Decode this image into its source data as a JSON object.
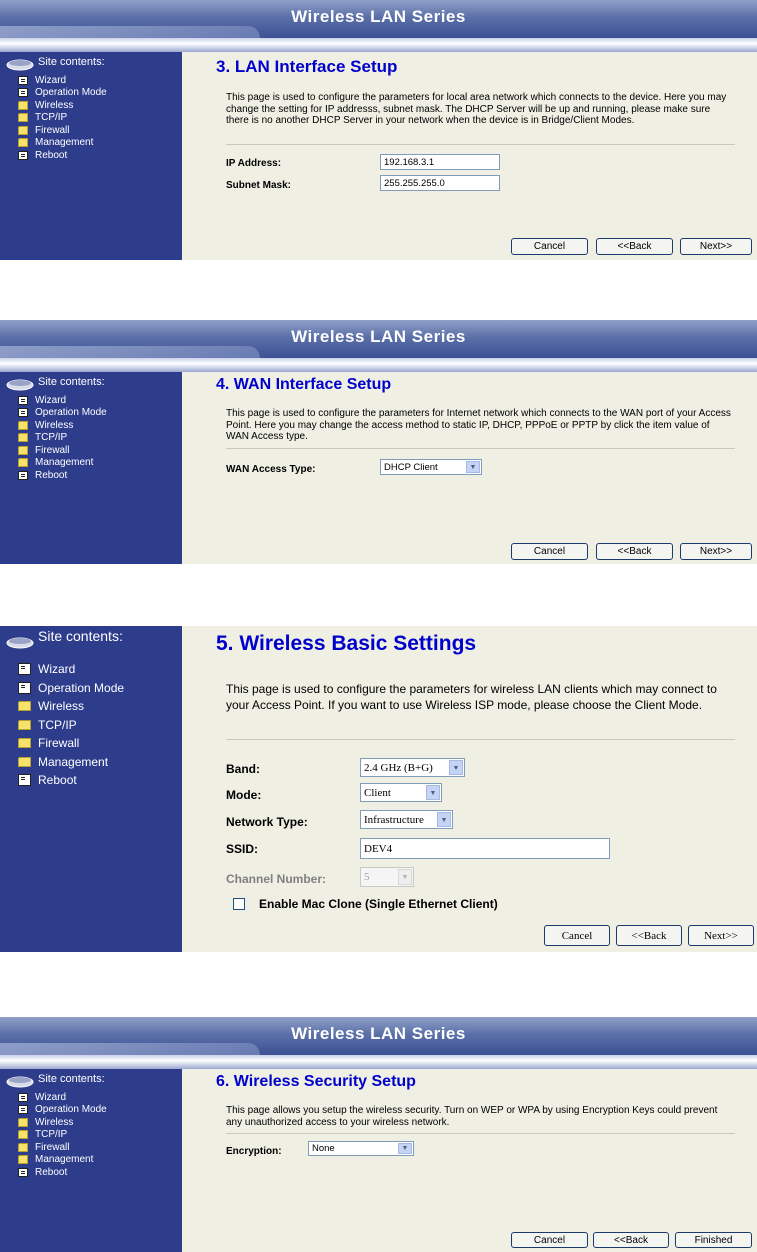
{
  "app_title": "Wireless LAN Series",
  "site_contents": "Site contents:",
  "nav": [
    "Wizard",
    "Operation Mode",
    "Wireless",
    "TCP/IP",
    "Firewall",
    "Management",
    "Reboot"
  ],
  "buttons": {
    "cancel": "Cancel",
    "back": "<<Back",
    "next": "Next>>",
    "finished": "Finished"
  },
  "panels": {
    "lan": {
      "heading": "3. LAN Interface Setup",
      "desc": "This page is used to configure the parameters for local area network which connects to the device. Here you may change the setting for IP addresss, subnet mask. The DHCP Server will be up and running, please make sure there is no another DHCP Server in your network when the device is in Bridge/Client Modes.",
      "ip_label": "IP Address:",
      "ip_value": "192.168.3.1",
      "mask_label": "Subnet Mask:",
      "mask_value": "255.255.255.0"
    },
    "wan": {
      "heading": "4. WAN Interface Setup",
      "desc": "This page is used to configure the parameters for Internet network which connects to the WAN port of your Access Point. Here you may change the access method to static IP, DHCP, PPPoE or PPTP by click the item value of WAN Access type.",
      "type_label": "WAN Access Type:",
      "type_value": "DHCP Client"
    },
    "wireless": {
      "heading": "5. Wireless Basic Settings",
      "desc": "This page is used to configure the parameters for wireless LAN clients which may connect to your Access Point. If you want to use Wireless ISP mode, please choose the Client Mode.",
      "band_label": "Band:",
      "band_value": "2.4 GHz (B+G)",
      "mode_label": "Mode:",
      "mode_value": "Client",
      "nettype_label": "Network Type:",
      "nettype_value": "Infrastructure",
      "ssid_label": "SSID:",
      "ssid_value": "DEV4",
      "channel_label": "Channel Number:",
      "channel_value": "5",
      "mac_clone_label": "Enable Mac Clone (Single Ethernet Client)"
    },
    "security": {
      "heading": "6. Wireless Security Setup",
      "desc": "This page allows you setup the wireless security. Turn on WEP or WPA by using Encryption Keys could prevent any unauthorized access to your wireless network.",
      "enc_label": "Encryption:",
      "enc_value": "None"
    }
  }
}
